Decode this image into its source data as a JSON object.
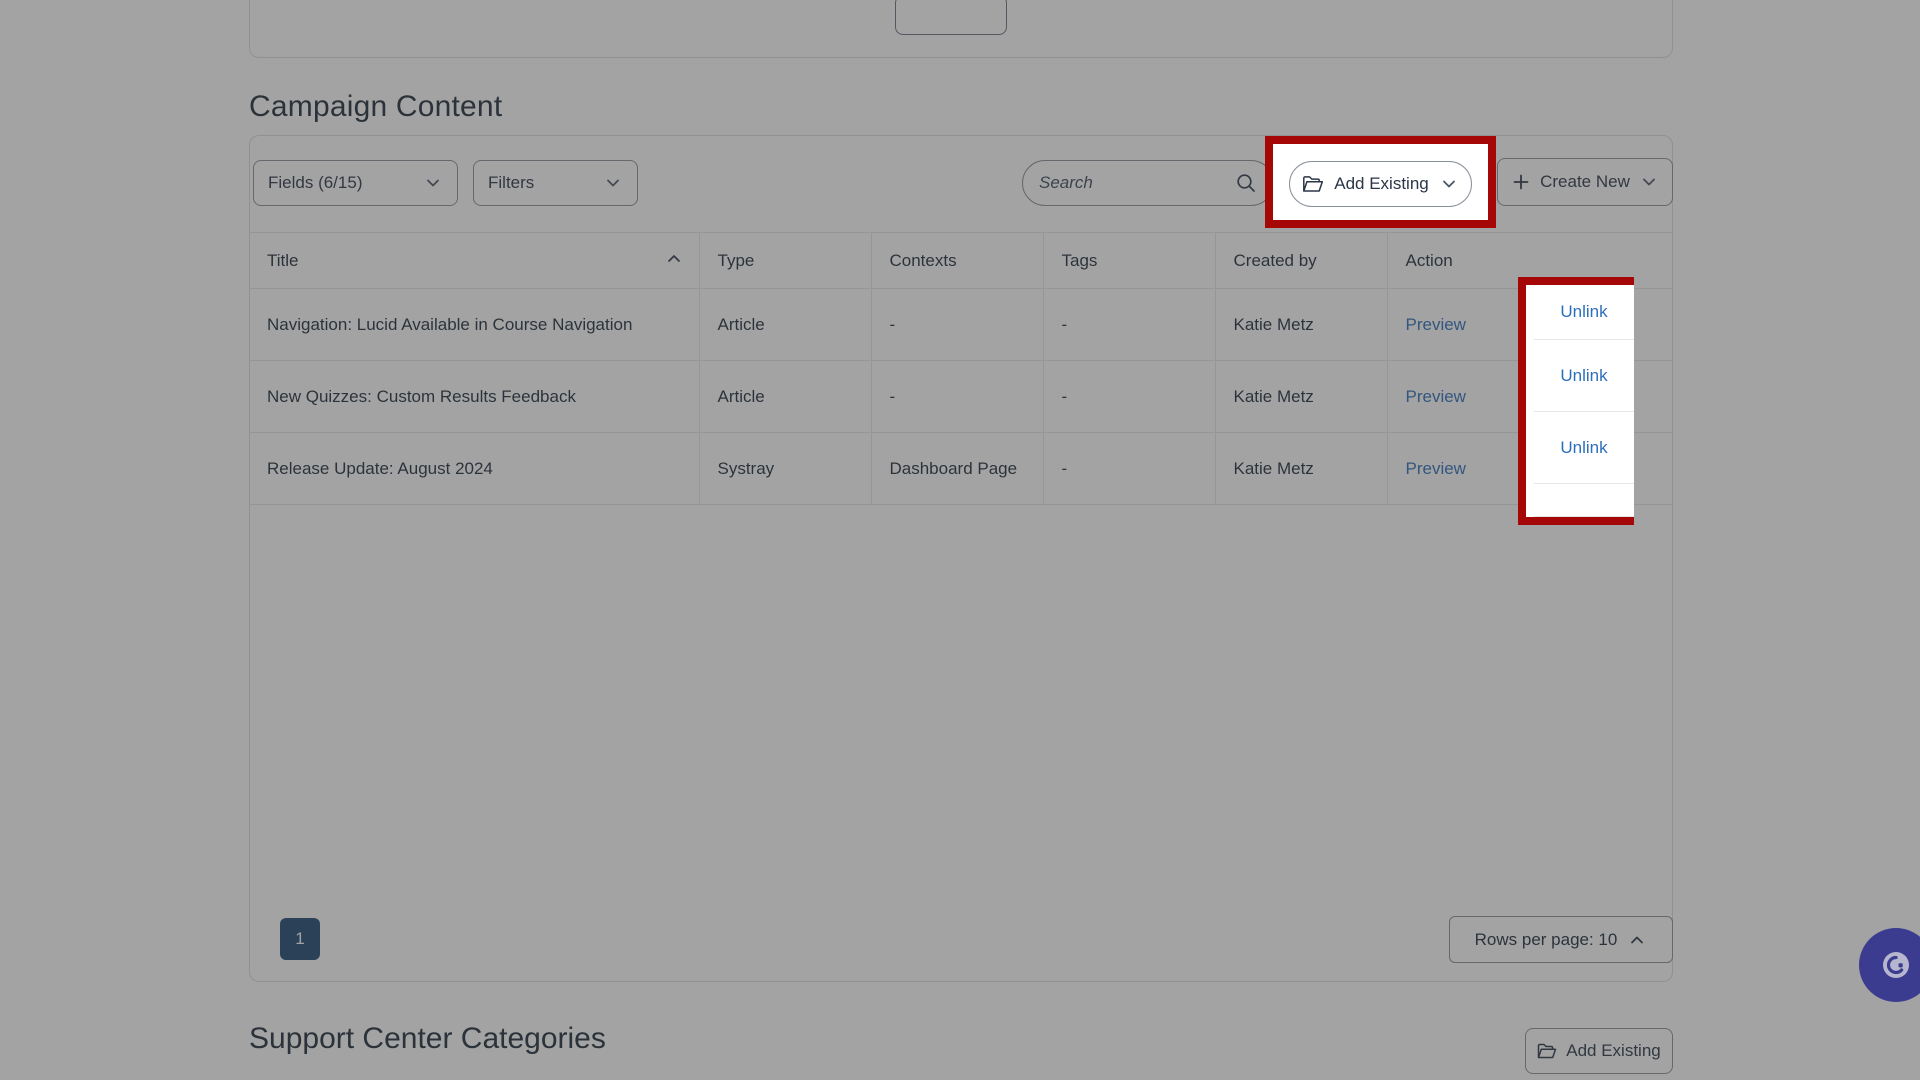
{
  "section": {
    "title": "Campaign Content"
  },
  "toolbar": {
    "fields_label": "Fields (6/15)",
    "filters_label": "Filters",
    "search_placeholder": "Search",
    "search_value": "",
    "add_existing_label": "Add Existing",
    "create_new_label": "Create New"
  },
  "table": {
    "columns": [
      "Title",
      "Type",
      "Contexts",
      "Tags",
      "Created by",
      "Action"
    ],
    "sort": {
      "column": "Title",
      "direction": "asc"
    },
    "rows": [
      {
        "title": "Navigation: Lucid Available in Course Navigation",
        "type": "Article",
        "contexts": "-",
        "tags": "-",
        "created_by": "Katie Metz",
        "preview": "Preview",
        "unlink": "Unlink"
      },
      {
        "title": "New Quizzes: Custom Results Feedback",
        "type": "Article",
        "contexts": "-",
        "tags": "-",
        "created_by": "Katie Metz",
        "preview": "Preview",
        "unlink": "Unlink"
      },
      {
        "title": "Release Update: August 2024",
        "type": "Systray",
        "contexts": "Dashboard Page",
        "tags": "-",
        "created_by": "Katie Metz",
        "preview": "Preview",
        "unlink": "Unlink"
      }
    ]
  },
  "footer": {
    "current_page": "1",
    "rows_per_page_label": "Rows per page: 10"
  },
  "bottom_section": {
    "title": "Support Center Categories",
    "add_existing_label": "Add Existing"
  },
  "chat": {
    "icon": "chat-bubble-icon"
  },
  "colors": {
    "highlight_red": "#a50606",
    "link_blue": "#2c6fbb",
    "page_button_blue": "#1c4670",
    "chat_fab_purple": "#3b3b8f",
    "text_dark": "#1d2b3a"
  }
}
